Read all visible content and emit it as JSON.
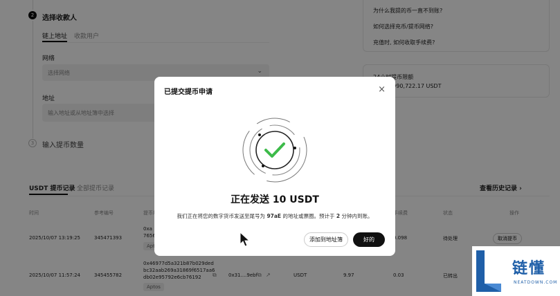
{
  "steps": {
    "step2": {
      "number": "2",
      "title": "选择收款人"
    },
    "step3": {
      "number": "3",
      "title": "输入提币数量"
    }
  },
  "recipient_tabs": [
    "链上地址",
    "收款用户"
  ],
  "network": {
    "label": "网络",
    "placeholder": "选择网络"
  },
  "address": {
    "label": "地址",
    "placeholder": "输入地址或从地址簿中选择"
  },
  "help_links": [
    "为什么我提的币一直不到账?",
    "如何选择充币/提币网络?",
    "充值时, 如何收取手续费?"
  ],
  "limit": {
    "title": "24小时提币限额",
    "value": "2.2 / 9,990,722.17 USDT"
  },
  "history_tabs": [
    "USDT 提币记录",
    "全部提币记录"
  ],
  "history_link": "查看历史记录",
  "table": {
    "headers": [
      "时间",
      "参考编号",
      "提币地址",
      "",
      "",
      "",
      "手续费",
      "状态",
      "操作"
    ],
    "rows": [
      {
        "time": "2025/10/07 13:19:25",
        "ref": "345471393",
        "address_lines": [
          "0xa",
          "7656"
        ],
        "network_tag": "Aptos",
        "fee": "0.098",
        "status": "待处理",
        "action": "取消提币"
      },
      {
        "time": "2025/10/07 11:57:24",
        "ref": "345455782",
        "address_lines": [
          "0x46977d5a321b87b029ded",
          "bc32aab269a31869f6517aa6",
          "db02e95792e6cb76192"
        ],
        "network_tag": "Aptos",
        "txid": "0x31....9ebf",
        "coin": "USDT",
        "amount": "9.97",
        "fee": "0.03",
        "status": "已转出"
      }
    ]
  },
  "modal": {
    "title": "已提交提币申请",
    "close_icon": "×",
    "heading": "正在发送 10 USDT",
    "description_parts": [
      "我们正在将您的数字货币发送至尾号为 ",
      "97aE",
      " 的地址或票圈。预计于 ",
      "2",
      " 分钟内到账。"
    ],
    "button_add": "添加到地址簿",
    "button_ok": "好的",
    "success_color": "#3dbb4a"
  },
  "watermark": {
    "text": "链懂",
    "sub": "NEATDOWN.COM"
  }
}
